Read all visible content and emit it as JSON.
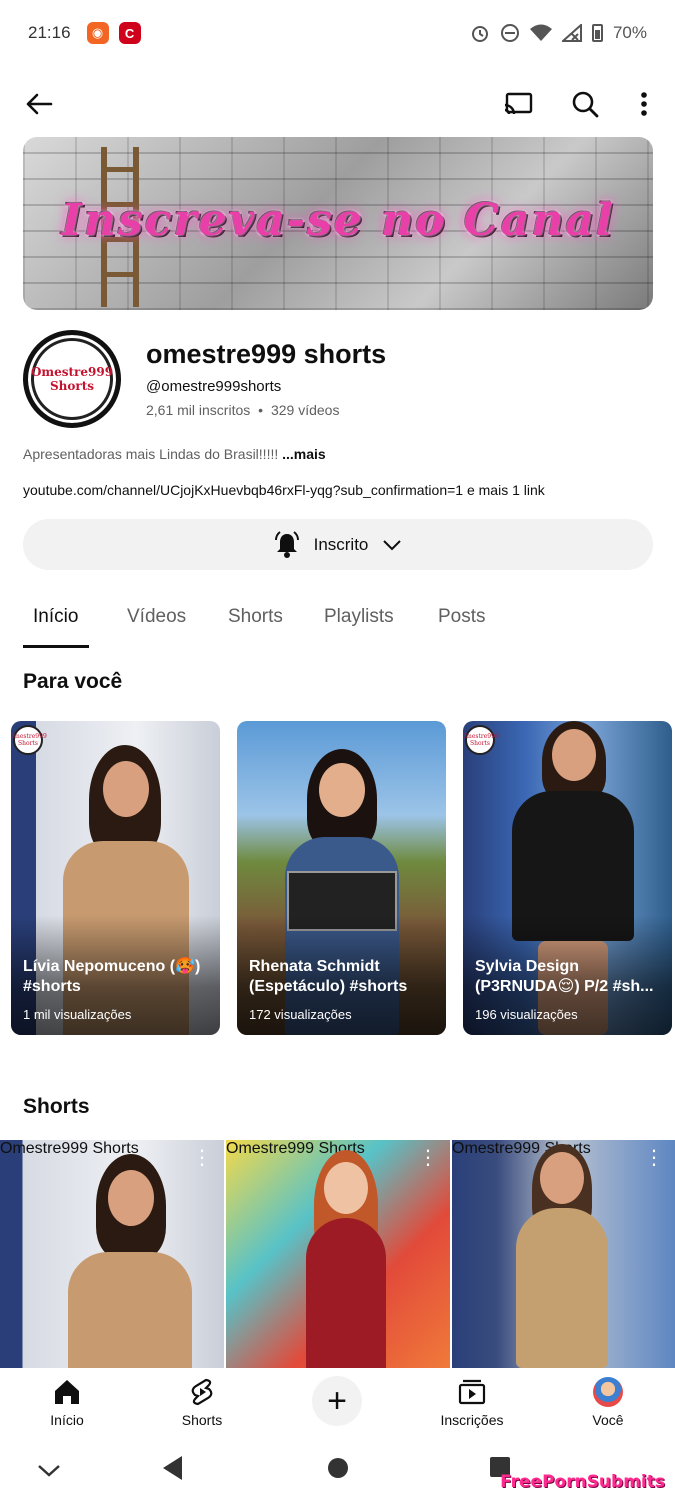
{
  "status_bar": {
    "time": "21:16",
    "battery": "70%"
  },
  "app_bar": {
    "icons": [
      "back-arrow-icon",
      "cast-icon",
      "search-icon",
      "more-vert-icon"
    ]
  },
  "banner": {
    "text": "Inscreva-se no Canal"
  },
  "channel": {
    "avatar_text_1": "Omestre999",
    "avatar_text_2": "Shorts",
    "name": "omestre999 shorts",
    "handle": "@omestre999shorts",
    "subscribers": "2,61 mil inscritos",
    "separator": "•",
    "videos": "329 vídeos",
    "description": "Apresentadoras mais Lindas do Brasil!!!!!",
    "description_more": "...mais",
    "link": "youtube.com/channel/UCjojKxHuevbqb46rxFl-yqg?sub_confirmation=1",
    "link_more": "e mais 1 link",
    "subscribe_label": "Inscrito"
  },
  "tabs": [
    {
      "label": "Início",
      "active": true
    },
    {
      "label": "Vídeos",
      "active": false
    },
    {
      "label": "Shorts",
      "active": false
    },
    {
      "label": "Playlists",
      "active": false
    },
    {
      "label": "Posts",
      "active": false
    }
  ],
  "for_you": {
    "title": "Para você",
    "cards": [
      {
        "title": "Lívia Nepomuceno (🥵) #shorts",
        "views": "1 mil visualizações"
      },
      {
        "title": "Rhenata Schmidt (Espetáculo) #shorts",
        "views": "172 visualizações"
      },
      {
        "title": "Sylvia Design (P3RNUDA😌) P/2 #sh...",
        "views": "196 visualizações"
      }
    ]
  },
  "shorts": {
    "title": "Shorts"
  },
  "bottom_nav": [
    {
      "label": "Início",
      "icon": "home-icon"
    },
    {
      "label": "Shorts",
      "icon": "shorts-icon"
    },
    {
      "label": "",
      "icon": "create-plus-icon"
    },
    {
      "label": "Inscrições",
      "icon": "subscriptions-icon"
    },
    {
      "label": "Você",
      "icon": "avatar-icon"
    }
  ],
  "watermark": "FreePornSubmits",
  "colors": {
    "text_primary": "#0f0f0f",
    "text_secondary": "#606060",
    "pill_bg": "#f2f2f2",
    "banner_text": "#e83fa8"
  }
}
